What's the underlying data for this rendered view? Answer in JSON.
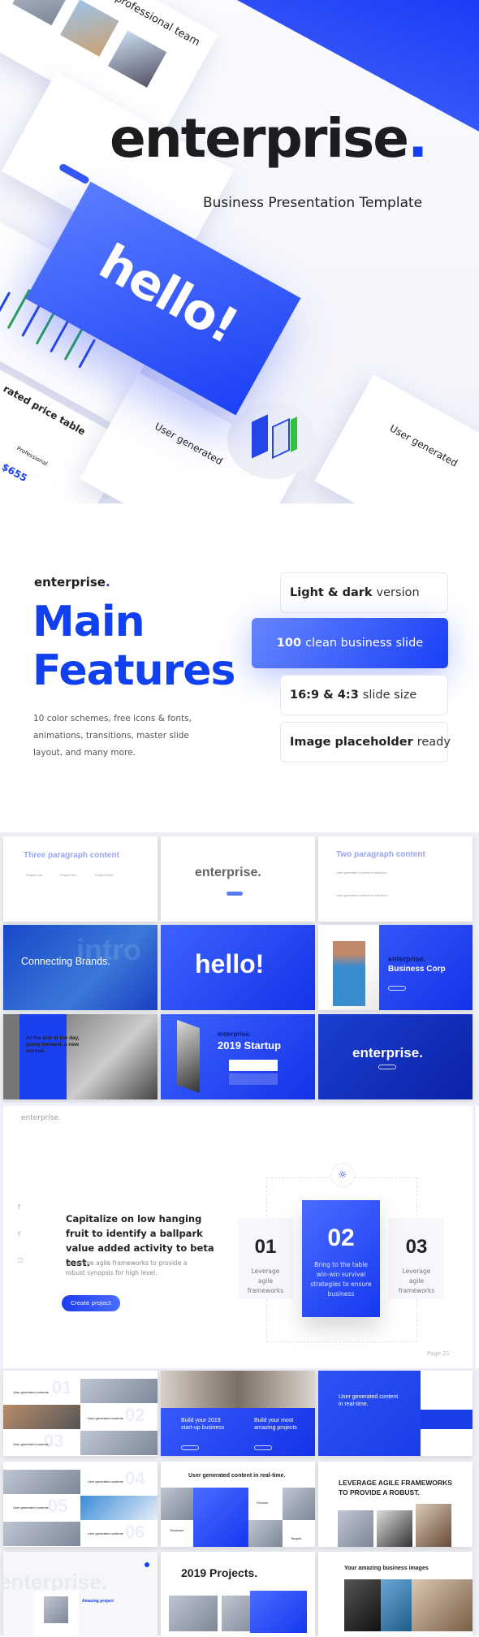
{
  "hero": {
    "brand": "enterprise",
    "brand_dot": ".",
    "subtitle": "Business Presentation Template",
    "mockups": {
      "team_title": "Our professional team",
      "hello": "hello!",
      "price_table": "rated price table",
      "plan": "Professional",
      "price": "$655",
      "user_generated_1": "User generated",
      "user_generated_2": "User generated"
    }
  },
  "features": {
    "brand": "enterprise",
    "brand_dot": ".",
    "title_line1": "Main",
    "title_line2": "Features",
    "description": "10 color schemes, free icons & fonts, animations, transitions, master slide layout, and many more.",
    "items": [
      {
        "bold": "Light & dark",
        "rest": "version",
        "active": false
      },
      {
        "bold": "100",
        "rest": "clean business slide",
        "active": true
      },
      {
        "bold": "16:9 & 4:3",
        "rest": "slide size",
        "active": false
      },
      {
        "bold": "Image placeholder",
        "rest": "ready",
        "active": false
      }
    ]
  },
  "grid1": {
    "s1": {
      "title": "Three paragraph content",
      "cols": [
        "Project one",
        "Project two",
        "Project three"
      ]
    },
    "s2": {
      "title": "enterprise."
    },
    "s3": {
      "title": "Two paragraph content",
      "bullet1": "User generated content in real-time.",
      "bullet2": "User generated content in real-time."
    },
    "s4": {
      "title": "Connecting Brands.",
      "watermark": "intro"
    },
    "s5": {
      "title": "hello!"
    },
    "s6": {
      "brand": "enterprise.",
      "title": "Business Corp"
    },
    "s7": {
      "title": "At the end of the day, going forward, a new normal."
    },
    "s8": {
      "brand": "enterprise.",
      "title": "2019 Startup"
    },
    "s9": {
      "title": "enterprise."
    }
  },
  "big": {
    "brand": "enterprise.",
    "heading": "Capitalize on low hanging fruit to identify a ballpark value added activity to beta test.",
    "sub": "Leverage agile frameworks to provide a robust synopsis for high level.",
    "button": "Create project",
    "cards": [
      {
        "num": "01",
        "text": "Leverage agile frameworks"
      },
      {
        "num": "02",
        "text": "Bring to the table win-win survival strategies to ensure business"
      },
      {
        "num": "03",
        "text": "Leverage agile frameworks"
      }
    ],
    "page_label": "Page",
    "page_num": "21",
    "icons": [
      "facebook-icon",
      "twitter-icon",
      "instagram-icon",
      "lightbulb-icon"
    ]
  },
  "grid2": {
    "s1": {
      "items": [
        "User generated contents",
        "User generated contents",
        "User generated contents"
      ],
      "nums": [
        "01",
        "02",
        "03"
      ]
    },
    "s2": {
      "col1": "Build your 2019 start-up business",
      "col2": "Build your most amazing projects"
    },
    "s3": {
      "title": "User generated content in real-time."
    },
    "s4": {
      "items": [
        "User generated contents",
        "User generated contents",
        "User generated contents"
      ],
      "nums": [
        "04",
        "05",
        "06"
      ]
    },
    "s5": {
      "title": "User generated content in real-time.",
      "labels": [
        "Business",
        "Finance",
        "Targets"
      ]
    },
    "s6": {
      "title": "LEVERAGE AGILE FRAMEWORKS TO PROVIDE A ROBUST."
    },
    "s7": {
      "watermark": "enterprise.",
      "title": "Amazing project"
    },
    "s8": {
      "title": "2019 Projects."
    },
    "s9": {
      "title": "Your amazing business images"
    }
  },
  "colors": {
    "accent": "#1340f5",
    "text": "#1d1d1f"
  }
}
